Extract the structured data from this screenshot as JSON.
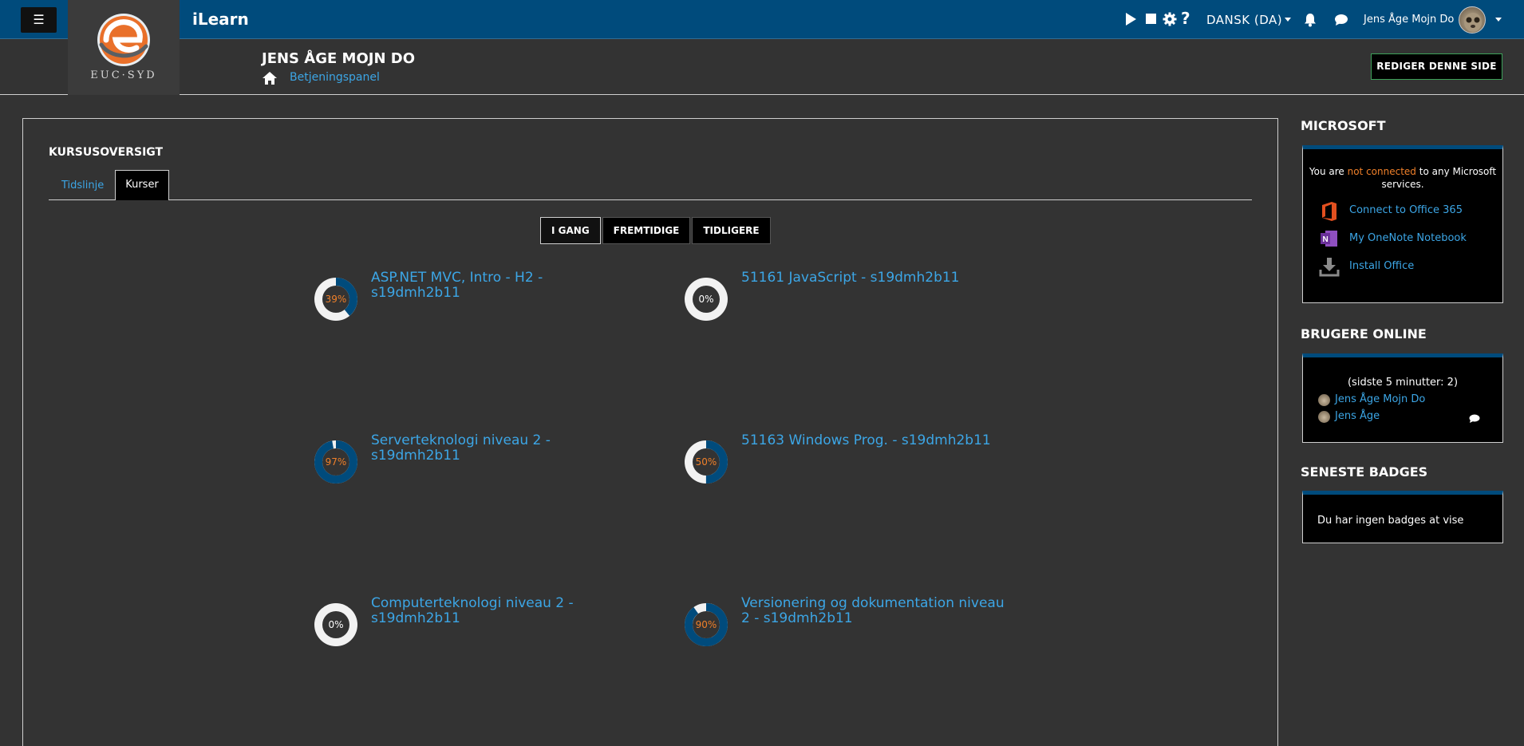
{
  "navbar": {
    "menu_glyph": "☰",
    "brand": "iLearn",
    "logo_text": "EUC·SYD",
    "icons": [
      "play-icon",
      "stop-icon",
      "gear-icon",
      "help-icon",
      "bell-icon",
      "chat-icon"
    ],
    "language": "DANSK (DA)",
    "user_name": "Jens Åge Mojn Do"
  },
  "header": {
    "title": "JENS ÅGE MOJN DO",
    "breadcrumb": "Betjeningspanel",
    "edit_button": "REDIGER DENNE SIDE"
  },
  "course_overview": {
    "title": "KURSUSOVERSIGT",
    "tabs": [
      "Tidslinje",
      "Kurser"
    ],
    "active_tab": "Kurser",
    "filters": [
      "I GANG",
      "FREMTIDIGE",
      "TIDLIGERE"
    ],
    "active_filter": "I GANG",
    "courses": [
      {
        "name": "ASP.NET MVC, Intro - H2 - s19dmh2b11",
        "progress": 39,
        "progress_label": "39%"
      },
      {
        "name": "51161 JavaScript - s19dmh2b11",
        "progress": 0,
        "progress_label": "0%"
      },
      {
        "name": "Serverteknologi niveau 2 - s19dmh2b11",
        "progress": 97,
        "progress_label": "97%"
      },
      {
        "name": "51163 Windows Prog. - s19dmh2b11",
        "progress": 50,
        "progress_label": "50%"
      },
      {
        "name": "Computerteknologi niveau 2 - s19dmh2b11",
        "progress": 0,
        "progress_label": "0%"
      },
      {
        "name": "Versionering og dokumentation niveau 2 - s19dmh2b11",
        "progress": 90,
        "progress_label": "90%"
      }
    ]
  },
  "sidebar": {
    "microsoft": {
      "title": "MICROSOFT",
      "status_pre": "You are",
      "status_warn": "not connected",
      "status_post": "to any Microsoft services.",
      "links": [
        "Connect to Office 365",
        "My OneNote Notebook",
        "Install Office"
      ]
    },
    "online": {
      "title": "BRUGERE ONLINE",
      "summary": "(sidste 5 minutter: 2)",
      "users": [
        "Jens Åge Mojn Do",
        "Jens Åge"
      ]
    },
    "badges": {
      "title": "SENESTE BADGES",
      "empty_text": "Du har ingen badges at vise"
    }
  },
  "colors": {
    "navbar": "#004b7c",
    "link": "#3ca6e6",
    "progress_fill": "#004b7c",
    "progress_track": "#f2f2f2",
    "progress_text": "#f0802a",
    "warning": "#f0802a",
    "edit_border": "#3da15a"
  }
}
